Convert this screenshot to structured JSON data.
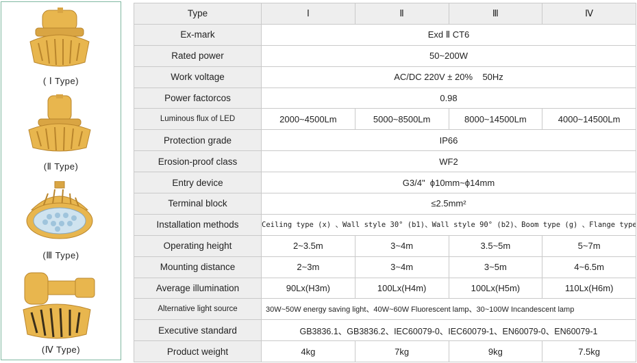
{
  "products": [
    {
      "caption": "( Ⅰ Type)"
    },
    {
      "caption": "(Ⅱ Type)"
    },
    {
      "caption": "(Ⅲ Type)"
    },
    {
      "caption": "(Ⅳ Type)"
    }
  ],
  "table": {
    "type_label": "Type",
    "types": [
      "Ⅰ",
      "Ⅱ",
      "Ⅲ",
      "Ⅳ"
    ],
    "rows": [
      {
        "label": "Ex-mark",
        "value": "Exd Ⅱ CT6"
      },
      {
        "label": "Rated power",
        "value": "50~200W"
      },
      {
        "label": "Work voltage",
        "value": "AC/DC 220V ± 20%    50Hz"
      },
      {
        "label": "Power factorcos",
        "value": "0.98"
      },
      {
        "label": "Luminous flux of LED",
        "values": [
          "2000~4500Lm",
          "5000~8500Lm",
          "8000~14500Lm",
          "4000~14500Lm"
        ]
      },
      {
        "label": "Protection grade",
        "value": "IP66"
      },
      {
        "label": "Erosion-proof class",
        "value": "WF2"
      },
      {
        "label": "Entry device",
        "value": "G3/4\"  ϕ10mm~ϕ14mm"
      },
      {
        "label": "Terminal block",
        "value": "≤2.5mm²"
      },
      {
        "label": "Installation methods",
        "value": "Ceiling type (x) 、Wall style 30° (b1)、Wall style 90° (b2)、Boom type (g) 、Flange type (f)"
      },
      {
        "label": "Operating height",
        "values": [
          "2~3.5m",
          "3~4m",
          "3.5~5m",
          "5~7m"
        ]
      },
      {
        "label": "Mounting distance",
        "values": [
          "2~3m",
          "3~4m",
          "3~5m",
          "4~6.5m"
        ]
      },
      {
        "label": "Average illumination",
        "values": [
          "90Lx(H3m)",
          "100Lx(H4m)",
          "100Lx(H5m)",
          "110Lx(H6m)"
        ]
      },
      {
        "label": "Alternative light source",
        "value": "30W~50W energy saving light、40W~60W Fluorescent lamp、30~100W Incandescent lamp"
      },
      {
        "label": "Executive standard",
        "value": "GB3836.1、GB3836.2、IEC60079-0、IEC60079-1、EN60079-0、EN60079-1"
      },
      {
        "label": "Product weight",
        "values": [
          "4kg",
          "7kg",
          "9kg",
          "7.5kg"
        ]
      }
    ]
  },
  "colors": {
    "lamp_body": "#e8b64e",
    "lamp_shadow": "#b9852c",
    "lamp_glass": "#cfe3ef",
    "panel_border": "#7fb7a0"
  }
}
